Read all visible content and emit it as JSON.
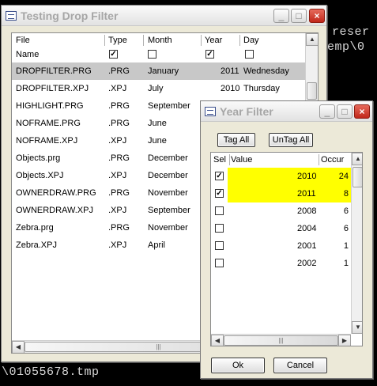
{
  "console": {
    "lines": [
      "reser",
      "emp\\0",
      "\\01055678.tmp"
    ]
  },
  "main_window": {
    "title": "Testing Drop Filter",
    "columns": [
      "File",
      "Type",
      "Month",
      "Year",
      "Day"
    ],
    "filter_row": {
      "label": "Name",
      "type_checked": true,
      "month_checked": false,
      "year_checked": true,
      "day_checked": false
    },
    "rows": [
      {
        "file": "DROPFILTER.PRG",
        "type": ".PRG",
        "month": "January",
        "year": "2011",
        "day": "Wednesday",
        "selected": true
      },
      {
        "file": "DROPFILTER.XPJ",
        "type": ".XPJ",
        "month": "July",
        "year": "2010",
        "day": "Thursday",
        "selected": false
      },
      {
        "file": "HIGHLIGHT.PRG",
        "type": ".PRG",
        "month": "September",
        "year": "",
        "day": "",
        "selected": false
      },
      {
        "file": "NOFRAME.PRG",
        "type": ".PRG",
        "month": "June",
        "year": "",
        "day": "",
        "selected": false
      },
      {
        "file": "NOFRAME.XPJ",
        "type": ".XPJ",
        "month": "June",
        "year": "",
        "day": "",
        "selected": false
      },
      {
        "file": "Objects.prg",
        "type": ".PRG",
        "month": "December",
        "year": "",
        "day": "",
        "selected": false
      },
      {
        "file": "Objects.XPJ",
        "type": ".XPJ",
        "month": "December",
        "year": "",
        "day": "",
        "selected": false
      },
      {
        "file": "OWNERDRAW.PRG",
        "type": ".PRG",
        "month": "November",
        "year": "",
        "day": "",
        "selected": false
      },
      {
        "file": "OWNERDRAW.XPJ",
        "type": ".XPJ",
        "month": "September",
        "year": "",
        "day": "",
        "selected": false
      },
      {
        "file": "Zebra.prg",
        "type": ".PRG",
        "month": "November",
        "year": "",
        "day": "",
        "selected": false
      },
      {
        "file": "Zebra.XPJ",
        "type": ".XPJ",
        "month": "April",
        "year": "",
        "day": "",
        "selected": false
      }
    ],
    "hscroll_grip": "|||"
  },
  "year_filter": {
    "title": "Year Filter",
    "tag_all_label": "Tag All",
    "untag_all_label": "UnTag All",
    "columns": [
      "Sel",
      "Value",
      "Occur"
    ],
    "rows": [
      {
        "checked": true,
        "value": "2010",
        "occur": "24",
        "highlight": true
      },
      {
        "checked": true,
        "value": "2011",
        "occur": "8",
        "highlight": true
      },
      {
        "checked": false,
        "value": "2008",
        "occur": "6",
        "highlight": false
      },
      {
        "checked": false,
        "value": "2004",
        "occur": "6",
        "highlight": false
      },
      {
        "checked": false,
        "value": "2001",
        "occur": "1",
        "highlight": false
      },
      {
        "checked": false,
        "value": "2002",
        "occur": "1",
        "highlight": false
      }
    ],
    "ok_label": "Ok",
    "cancel_label": "Cancel",
    "hscroll_grip": "|||"
  },
  "window_buttons": {
    "minimize": "_",
    "maximize": "□",
    "close": "×"
  },
  "check_glyph": "✓",
  "arrows": {
    "up": "▲",
    "down": "▼",
    "left": "◀",
    "right": "▶"
  }
}
